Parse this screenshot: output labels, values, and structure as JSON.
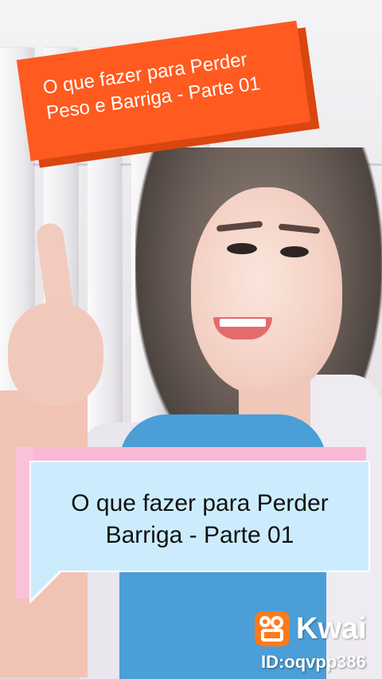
{
  "top_banner": {
    "line1": "O que fazer para Perder",
    "line2": "Peso e Barriga - Parte 01",
    "color": "#ff5a1f"
  },
  "caption": {
    "line1": "O que fazer para Perder",
    "line2": "Barriga - Parte 01",
    "box_color": "#ccecfd",
    "accent_color": "#f9b9d4"
  },
  "watermark": {
    "brand": "Kwai",
    "id_text": "ID:oqvpp386",
    "icon": "kwai-logo-icon",
    "brand_color": "#ff7a1a"
  }
}
